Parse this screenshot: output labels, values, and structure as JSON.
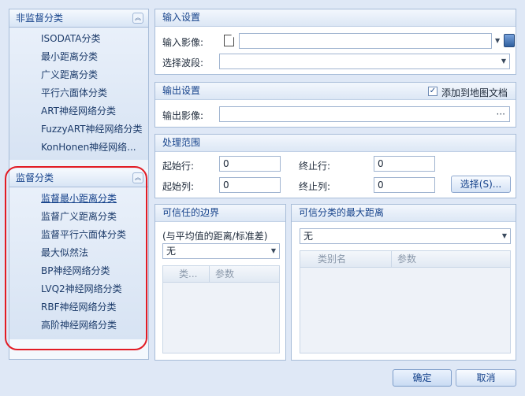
{
  "nav": {
    "unsupervised": {
      "title": "非监督分类",
      "items": [
        "ISODATA分类",
        "最小距离分类",
        "广义距离分类",
        "平行六面体分类",
        "ART神经网络分类",
        "FuzzyART神经网络分类",
        "KonHonen神经网络..."
      ]
    },
    "supervised": {
      "title": "监督分类",
      "items": [
        "监督最小距离分类",
        "监督广义距离分类",
        "监督平行六面体分类",
        "最大似然法",
        "BP神经网络分类",
        "LVQ2神经网络分类",
        "RBF神经网络分类",
        "高阶神经网络分类"
      ],
      "active_index": 0
    }
  },
  "input": {
    "title": "输入设置",
    "image_label": "输入影像:",
    "image_value": "",
    "band_label": "选择波段:",
    "band_value": ""
  },
  "output": {
    "title": "输出设置",
    "add_to_map_label": "添加到地图文档",
    "add_to_map_checked": true,
    "image_label": "输出影像:",
    "image_value": "",
    "browse": "···"
  },
  "range": {
    "title": "处理范围",
    "start_row_label": "起始行:",
    "start_row": "0",
    "end_row_label": "终止行:",
    "end_row": "0",
    "start_col_label": "起始列:",
    "start_col": "0",
    "end_col_label": "终止列:",
    "end_col": "0",
    "select_button": "选择(S)..."
  },
  "boundary": {
    "title": "可信任的边界",
    "subtitle": "(与平均值的距离/标准差)",
    "value": "无",
    "col1": "类...",
    "col2": "参数"
  },
  "maxdist": {
    "title": "可信分类的最大距离",
    "value": "无",
    "col1": "类别名",
    "col2": "参数"
  },
  "footer": {
    "ok": "确定",
    "cancel": "取消"
  },
  "colors": {
    "background": "#dfe8f6",
    "accent": "#15428b",
    "highlight_outline": "#e21b24"
  }
}
